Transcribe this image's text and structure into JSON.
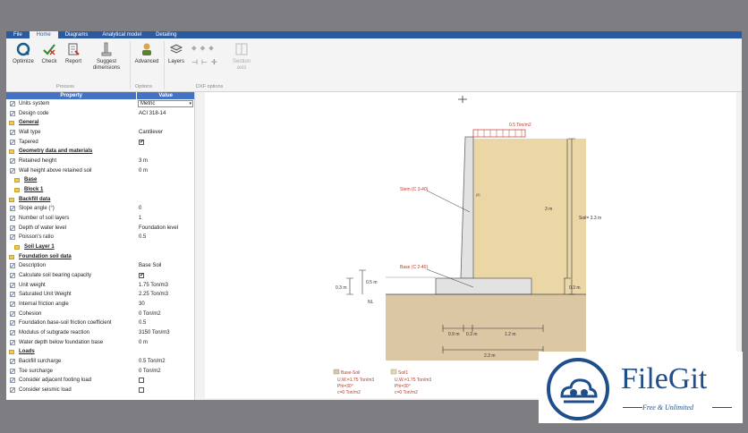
{
  "menu": [
    "File",
    "Home",
    "Diagrams",
    "Analytical model",
    "Detailing"
  ],
  "menu_active": "Home",
  "ribbon": {
    "optimize": "Optimize",
    "check": "Check",
    "report": "Report",
    "suggest": "Suggest dimensions",
    "advanced": "Advanced",
    "layers": "Layers",
    "section_axis": "Section axis",
    "group_process": "Process",
    "group_options": "Options",
    "group_dxf": "DXF options"
  },
  "panel": {
    "header_property": "Property",
    "header_value": "Value",
    "rows": [
      {
        "kind": "item",
        "label": "Units system",
        "value": "Metric",
        "select": true
      },
      {
        "kind": "item",
        "label": "Design code",
        "value": "ACI 318-14"
      },
      {
        "kind": "sec",
        "label": "General"
      },
      {
        "kind": "item",
        "label": "Wall type",
        "value": "Cantilever"
      },
      {
        "kind": "item",
        "label": "Tapered",
        "check": true
      },
      {
        "kind": "sec",
        "label": "Geometry data and materials"
      },
      {
        "kind": "item",
        "label": "Retained height",
        "value": "3 m"
      },
      {
        "kind": "item",
        "label": "Wall height above retained soil",
        "value": "0 m"
      },
      {
        "kind": "sub",
        "label": "Base"
      },
      {
        "kind": "sub",
        "label": "Block 1"
      },
      {
        "kind": "sec",
        "label": "Backfill data"
      },
      {
        "kind": "item",
        "label": "Slope angle (°)",
        "value": "0"
      },
      {
        "kind": "item",
        "label": "Number of soil layers",
        "value": "1"
      },
      {
        "kind": "item",
        "label": "Depth of water level",
        "value": "Foundation level"
      },
      {
        "kind": "item",
        "label": "Poisson's ratio",
        "value": "0.5"
      },
      {
        "kind": "sub",
        "label": "Soil Layer 1"
      },
      {
        "kind": "sec",
        "label": "Foundation soil data"
      },
      {
        "kind": "item",
        "label": "Description",
        "value": "Base Soil"
      },
      {
        "kind": "item",
        "label": "Calculate soil bearing capacity",
        "check": true
      },
      {
        "kind": "item",
        "label": "Unit weight",
        "value": "1.75 Ton/m3"
      },
      {
        "kind": "item",
        "label": "Saturated Unit Weight",
        "value": "2.25 Ton/m3"
      },
      {
        "kind": "item",
        "label": "Internal friction angle",
        "value": "30"
      },
      {
        "kind": "item",
        "label": "Cohesion",
        "value": "0 Ton/m2"
      },
      {
        "kind": "item",
        "label": "Foundation base-soil friction coefficient",
        "value": "0.5"
      },
      {
        "kind": "item",
        "label": "Modulus of subgrade reaction",
        "value": "3150 Ton/m3"
      },
      {
        "kind": "item",
        "label": "Water depth below foundation base",
        "value": "0 m"
      },
      {
        "kind": "sec",
        "label": "Loads"
      },
      {
        "kind": "item",
        "label": "Backfill surcharge",
        "value": "0.5 Ton/m2"
      },
      {
        "kind": "item",
        "label": "Toe surcharge",
        "value": "0 Ton/m2"
      },
      {
        "kind": "item",
        "label": "Consider adjacent footing load",
        "check": false
      },
      {
        "kind": "item",
        "label": "Consider seismic load",
        "check": false
      }
    ]
  },
  "drawing": {
    "surcharge": "0.5 Ton/m2",
    "stem_label": "Stem (C 3-40)",
    "base_label": "Base (C 2-40)",
    "dim_3m": "3 m",
    "dim_soil": "Soil= 3.3 m",
    "dim_03m": "0.3 m",
    "dim_03m_b": "0.3 m",
    "dim_05m": "0.5 m",
    "dim_09m": "0.9 m",
    "dim_04m": "0.3 m",
    "dim_12m": "1.2 m",
    "dim_total": "2.3 m",
    "nl": "NL",
    "legend_base_title": "Base-Soil",
    "legend_base_1": "U.W.=1.75 Ton/m3",
    "legend_base_2": "Phi=30°",
    "legend_base_3": "c=0 Ton/m2",
    "legend_soil_title": "Soil1",
    "legend_soil_1": "U.W.=1.75 Ton/m3",
    "legend_soil_2": "Phi=30°",
    "legend_soil_3": "c=0 Ton/m2"
  },
  "watermark": {
    "title": "FileGit",
    "subtitle": "Free & Unlimited"
  },
  "colors": {
    "accent": "#2c5aa0",
    "soil": "#ebd6a6",
    "base_soil": "#dcc7a4",
    "concrete": "#e2e2e2",
    "header": "#4472c4"
  }
}
